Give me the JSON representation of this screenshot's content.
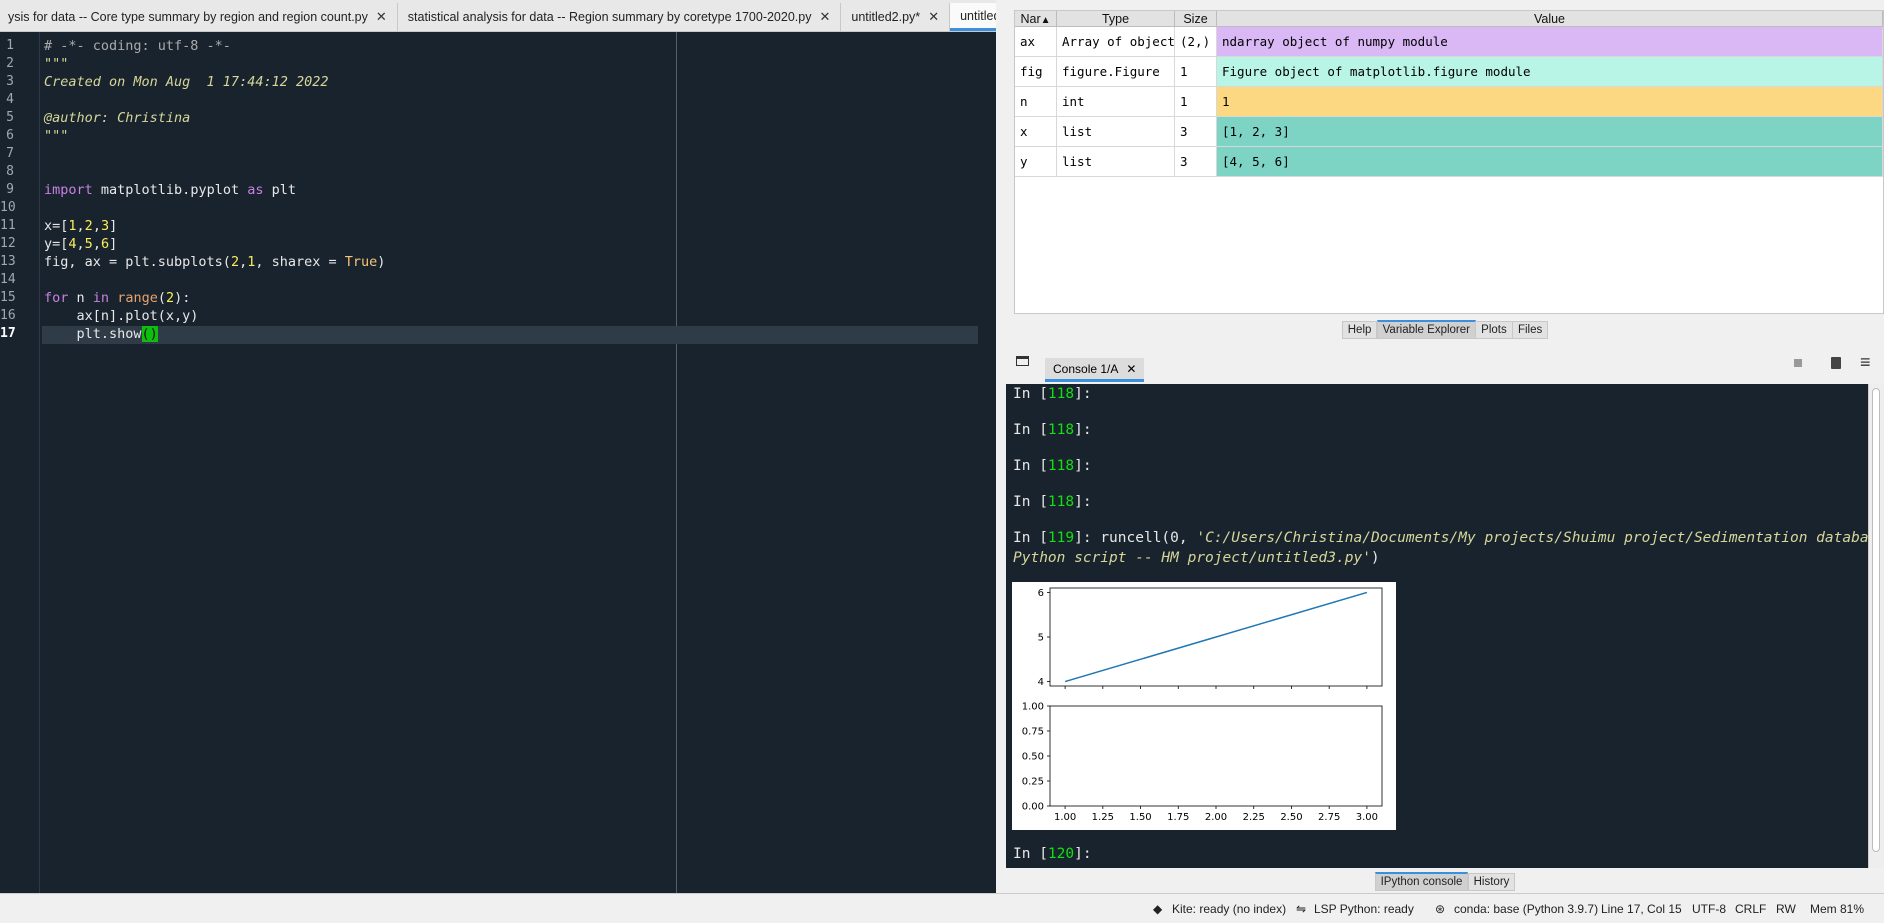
{
  "editor": {
    "tabs": [
      {
        "label": "ysis for data -- Core type summary by region and region count.py",
        "active": false
      },
      {
        "label": "statistical analysis for data -- Region summary by coretype 1700-2020.py",
        "active": false
      },
      {
        "label": "untitled2.py*",
        "active": false
      },
      {
        "label": "untitled3.py*",
        "active": true
      }
    ],
    "line_numbers": [
      "1",
      "2",
      "3",
      "4",
      "5",
      "6",
      "7",
      "8",
      "9",
      "10",
      "11",
      "12",
      "13",
      "14",
      "15",
      "16",
      "17"
    ],
    "lines": [
      "# -*- coding: utf-8 -*-",
      "\"\"\"",
      "Created on Mon Aug  1 17:44:12 2022",
      "",
      "@author: Christina",
      "\"\"\"",
      "",
      "",
      "import matplotlib.pyplot as plt",
      "",
      "x=[1,2,3]",
      "y=[4,5,6]",
      "fig, ax = plt.subplots(2,1, sharex = True)",
      "",
      "for n in range(2):",
      "    ax[n].plot(x,y)",
      "    plt.show()"
    ],
    "current_line": 17
  },
  "variable_explorer": {
    "headers": [
      "Nar",
      "Type",
      "Size",
      "Value"
    ],
    "rows": [
      {
        "name": "ax",
        "type": "Array of object",
        "size": "(2,)",
        "value": "ndarray object of numpy module",
        "color": "#d9b8f5"
      },
      {
        "name": "fig",
        "type": "figure.Figure",
        "size": "1",
        "value": "Figure object of matplotlib.figure module",
        "color": "#b9f5e6"
      },
      {
        "name": "n",
        "type": "int",
        "size": "1",
        "value": "1",
        "color": "#fdd882"
      },
      {
        "name": "x",
        "type": "list",
        "size": "3",
        "value": "[1, 2, 3]",
        "color": "#7ed4c4"
      },
      {
        "name": "y",
        "type": "list",
        "size": "3",
        "value": "[4, 5, 6]",
        "color": "#7ed4c4"
      }
    ],
    "pane_tabs": [
      "Help",
      "Variable Explorer",
      "Plots",
      "Files"
    ],
    "active_pane_tab": "Variable Explorer"
  },
  "console": {
    "tab_label": "Console 1/A",
    "prompts": [
      {
        "n": "118",
        "text": ""
      },
      {
        "n": "118",
        "text": ""
      },
      {
        "n": "118",
        "text": ""
      },
      {
        "n": "118",
        "text": ""
      }
    ],
    "run_prompt_n": "119",
    "run_cmd": "runcell(0, ",
    "run_path_1": "'C:/Users/Christina/Documents/My projects/Shuimu project/Sedimentation database/",
    "run_path_2": "Python script -- HM project/untitled3.py'",
    "run_tail": ")",
    "last_prompt_n": "120",
    "bottom_tabs": [
      "IPython console",
      "History"
    ],
    "active_bottom_tab": "IPython console"
  },
  "chart_data": [
    {
      "type": "line",
      "x": [
        1,
        2,
        3
      ],
      "series": [
        {
          "values": [
            4,
            5,
            6
          ]
        }
      ],
      "yticks": [
        "4",
        "5",
        "6"
      ],
      "ylim": [
        3.9,
        6.1
      ]
    },
    {
      "type": "line",
      "x": [],
      "series": [],
      "yticks": [
        "0.00",
        "0.25",
        "0.50",
        "0.75",
        "1.00"
      ],
      "xticks": [
        "1.00",
        "1.25",
        "1.50",
        "1.75",
        "2.00",
        "2.25",
        "2.50",
        "2.75",
        "3.00"
      ],
      "ylim": [
        0,
        1
      ],
      "xlim": [
        0.9,
        3.1
      ]
    }
  ],
  "status": {
    "kite": "Kite: ready (no index)",
    "lsp": "LSP Python: ready",
    "conda": "conda: base (Python 3.9.7)",
    "position": "Line 17, Col 15",
    "encoding": "UTF-8",
    "eol": "CRLF",
    "rw": "RW",
    "mem": "Mem 81%"
  },
  "colors": {
    "line": "#1f77b4",
    "prompt": "#0fe10f",
    "accent": "#3c8fdc"
  }
}
